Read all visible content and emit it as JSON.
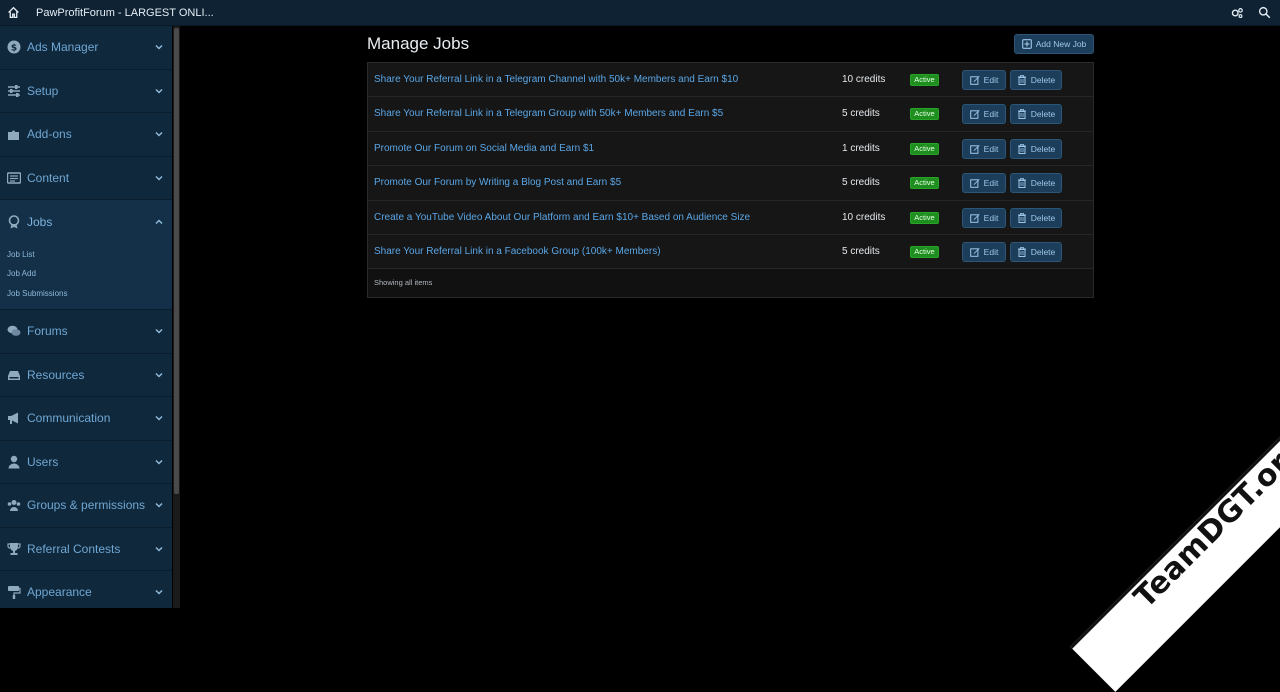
{
  "topbar": {
    "title": "PawProfitForum - LARGEST ONLI...",
    "icons": [
      "home-icon",
      "settings-icon",
      "search-icon"
    ]
  },
  "sidebar": {
    "items": [
      {
        "label": "Ads Manager",
        "icon": "dollar-icon",
        "expanded": false
      },
      {
        "label": "Setup",
        "icon": "sliders-icon",
        "expanded": false
      },
      {
        "label": "Add-ons",
        "icon": "puzzle-icon",
        "expanded": false
      },
      {
        "label": "Content",
        "icon": "content-icon",
        "expanded": false
      },
      {
        "label": "Jobs",
        "icon": "badge-icon",
        "expanded": true,
        "subitems": [
          "Job List",
          "Job Add",
          "Job Submissions"
        ]
      },
      {
        "label": "Forums",
        "icon": "comments-icon",
        "expanded": false
      },
      {
        "label": "Resources",
        "icon": "hdd-icon",
        "expanded": false
      },
      {
        "label": "Communication",
        "icon": "megaphone-icon",
        "expanded": false
      },
      {
        "label": "Users",
        "icon": "user-icon",
        "expanded": false
      },
      {
        "label": "Groups & permissions",
        "icon": "users-icon",
        "expanded": false
      },
      {
        "label": "Referral Contests",
        "icon": "trophy-icon",
        "expanded": false
      },
      {
        "label": "Appearance",
        "icon": "paint-icon",
        "expanded": false
      }
    ]
  },
  "main": {
    "title": "Manage Jobs",
    "add_button": "Add New Job",
    "status_label": "Active",
    "edit_label": "Edit",
    "delete_label": "Delete",
    "footer": "Showing all items",
    "jobs": [
      {
        "title": "Share Your Referral Link in a Telegram Channel with 50k+ Members and Earn $10",
        "credits": "10 credits"
      },
      {
        "title": "Share Your Referral Link in a Telegram Group with 50k+ Members and Earn $5",
        "credits": "5 credits"
      },
      {
        "title": "Promote Our Forum on Social Media and Earn $1",
        "credits": "1 credits"
      },
      {
        "title": "Promote Our Forum by Writing a Blog Post and Earn $5",
        "credits": "5 credits"
      },
      {
        "title": "Create a YouTube Video About Our Platform and Earn $10+ Based on Audience Size",
        "credits": "10 credits"
      },
      {
        "title": "Share Your Referral Link in a Facebook Group (100k+ Members)",
        "credits": "5 credits"
      }
    ]
  },
  "watermark": {
    "text": "TeamDGT.org"
  },
  "colors": {
    "accent": "#5aa6e6",
    "active_badge": "#1e8f1e",
    "sidebar_bg": "#10283b",
    "topbar_bg": "#0e2234"
  }
}
